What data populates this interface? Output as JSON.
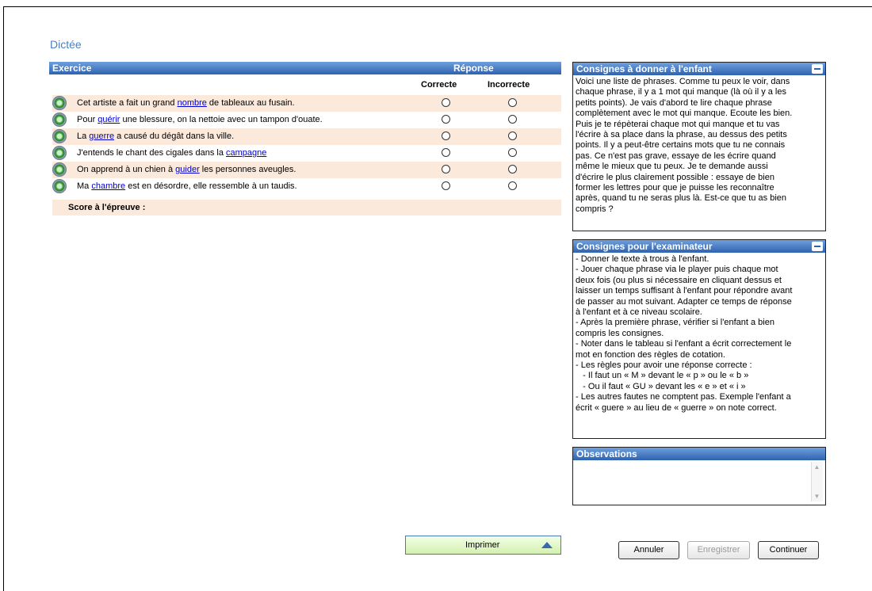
{
  "page": {
    "title": "Dictée"
  },
  "exercise": {
    "header_label": "Exercice",
    "response_label": "Réponse",
    "col_correct": "Correcte",
    "col_incorrect": "Incorrecte",
    "rows": [
      {
        "before": "Cet artiste a fait un grand ",
        "word": "nombre",
        "after": " de tableaux au fusain."
      },
      {
        "before": "Pour ",
        "word": "quérir",
        "after": " une blessure, on la nettoie avec un tampon d'ouate."
      },
      {
        "before": "La ",
        "word": "guerre",
        "after": " a causé du dégât dans la ville."
      },
      {
        "before": "J'entends le chant des cigales dans la ",
        "word": "campagne",
        "after": ""
      },
      {
        "before": "On apprend à un chien à ",
        "word": "guider",
        "after": " les personnes aveugles."
      },
      {
        "before": "Ma ",
        "word": "chambre",
        "after": " est en désordre, elle ressemble à un taudis."
      }
    ],
    "score_label": "Score à l'épreuve :"
  },
  "panels": {
    "child": {
      "title": "Consignes à donner à l'enfant",
      "lines": [
        "Voici une liste de phrases. Comme tu peux le voir, dans",
        "chaque phrase, il y a 1 mot qui manque (là où il y a les",
        "petits points). Je vais d'abord te lire chaque phrase",
        "complètement avec le mot qui manque. Ecoute les bien.",
        "Puis je te répèterai chaque mot qui manque et tu vas",
        "l'écrire à sa place dans la phrase, au dessus des petits",
        "points. Il y a peut-être certains mots que tu ne connais",
        "pas. Ce n'est pas grave, essaye de les écrire quand",
        "même le mieux que tu peux. Je te demande aussi",
        "d'écrire le plus clairement possible : essaye de bien",
        "former les lettres pour que je puisse les reconnaître",
        "après, quand tu ne seras plus là. Est-ce que tu as bien",
        "compris ?"
      ]
    },
    "examiner": {
      "title": "Consignes pour l'examinateur",
      "lines": [
        "- Donner le texte à trous à l'enfant.",
        "- Jouer chaque phrase via le player puis chaque mot",
        "deux fois (ou plus si nécessaire en cliquant dessus et",
        "laisser un temps suffisant à l'enfant pour répondre avant",
        "de passer au mot suivant. Adapter ce temps de réponse",
        "à l'enfant et à ce niveau scolaire.",
        "- Après la première phrase, vérifier si l'enfant a bien",
        "compris les consignes.",
        "- Noter dans le tableau si l'enfant a écrit correctement le",
        "mot en fonction des règles de cotation.",
        "- Les règles pour avoir une réponse correcte :",
        "   - Il faut un « M » devant le « p » ou le « b »",
        "   - Ou il faut « GU » devant les « e » et « i »",
        "- Les autres fautes ne comptent pas. Exemple l'enfant a",
        "écrit « guere » au lieu de « guerre » on note correct."
      ]
    },
    "observations": {
      "title": "Observations",
      "value": ""
    }
  },
  "buttons": {
    "print": "Imprimer",
    "cancel": "Annuler",
    "save": "Enregistrer",
    "continue": "Continuer"
  }
}
